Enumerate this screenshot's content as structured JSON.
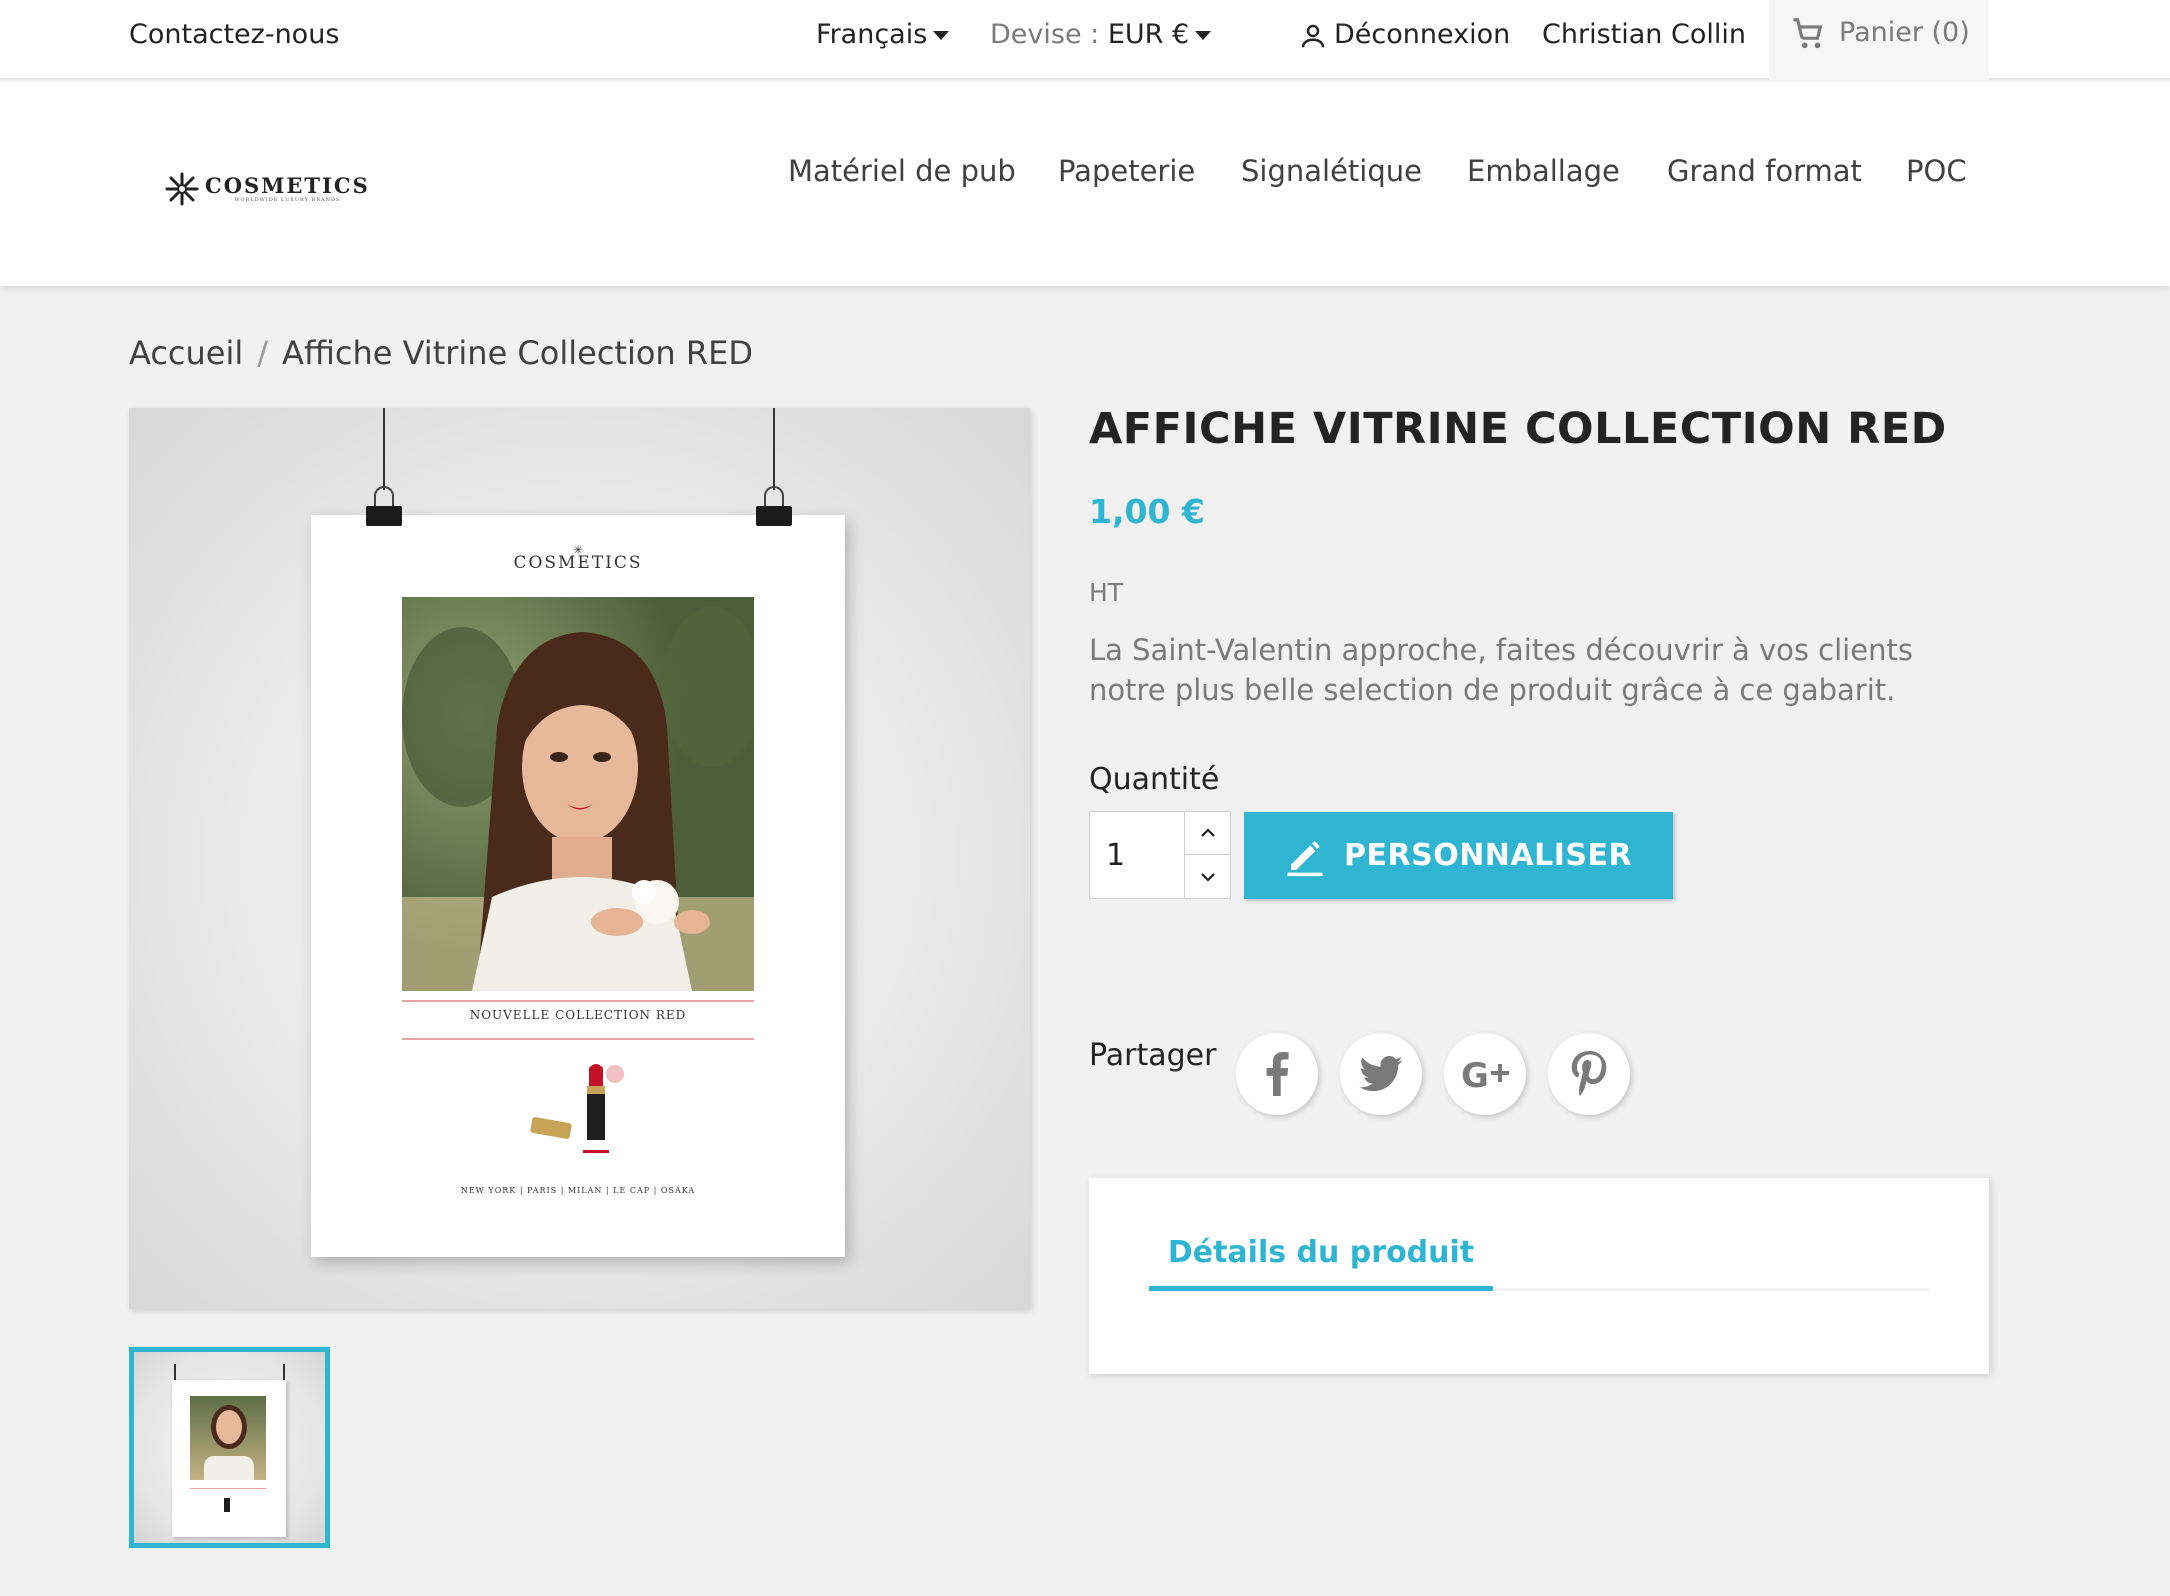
{
  "topbar": {
    "contact": "Contactez-nous",
    "language": "Français",
    "currency_label": "Devise :",
    "currency_value": "EUR €",
    "logout": "Déconnexion",
    "user_name": "Christian Collin",
    "cart": "Panier (0)"
  },
  "header": {
    "logo": {
      "main": "COSMETICS",
      "sub": "WORLDWIDE LUXURY BRANDS"
    },
    "nav": [
      "Matériel de pub",
      "Papeterie",
      "Signalétique",
      "Emballage",
      "Grand format",
      "POC"
    ]
  },
  "breadcrumb": {
    "home": "Accueil",
    "separator": "/",
    "current": "Affiche Vitrine Collection RED"
  },
  "product": {
    "title": "AFFICHE VITRINE COLLECTION RED",
    "price": "1,00 €",
    "tax_label": "HT",
    "description": "La Saint-Valentin approche, faites découvrir à vos clients notre plus belle selection de produit grâce à ce gabarit.",
    "quantity_label": "Quantité",
    "quantity_value": "1",
    "customize_button": "PERSONNALISER",
    "share_label": "Partager",
    "share_buttons": [
      "facebook-icon",
      "twitter-icon",
      "google-plus-icon",
      "pinterest-icon"
    ],
    "tab_details": "Détails du produit"
  },
  "poster": {
    "brand": "COSMETICS",
    "collection": "NOUVELLE COLLECTION RED",
    "cities": "NEW YORK | PARIS | MILAN | LE CAP | OSAKA"
  },
  "colors": {
    "accent": "#2fb5d2",
    "text": "#232323",
    "muted": "#7a7a7a",
    "background": "#f1f1f1"
  }
}
